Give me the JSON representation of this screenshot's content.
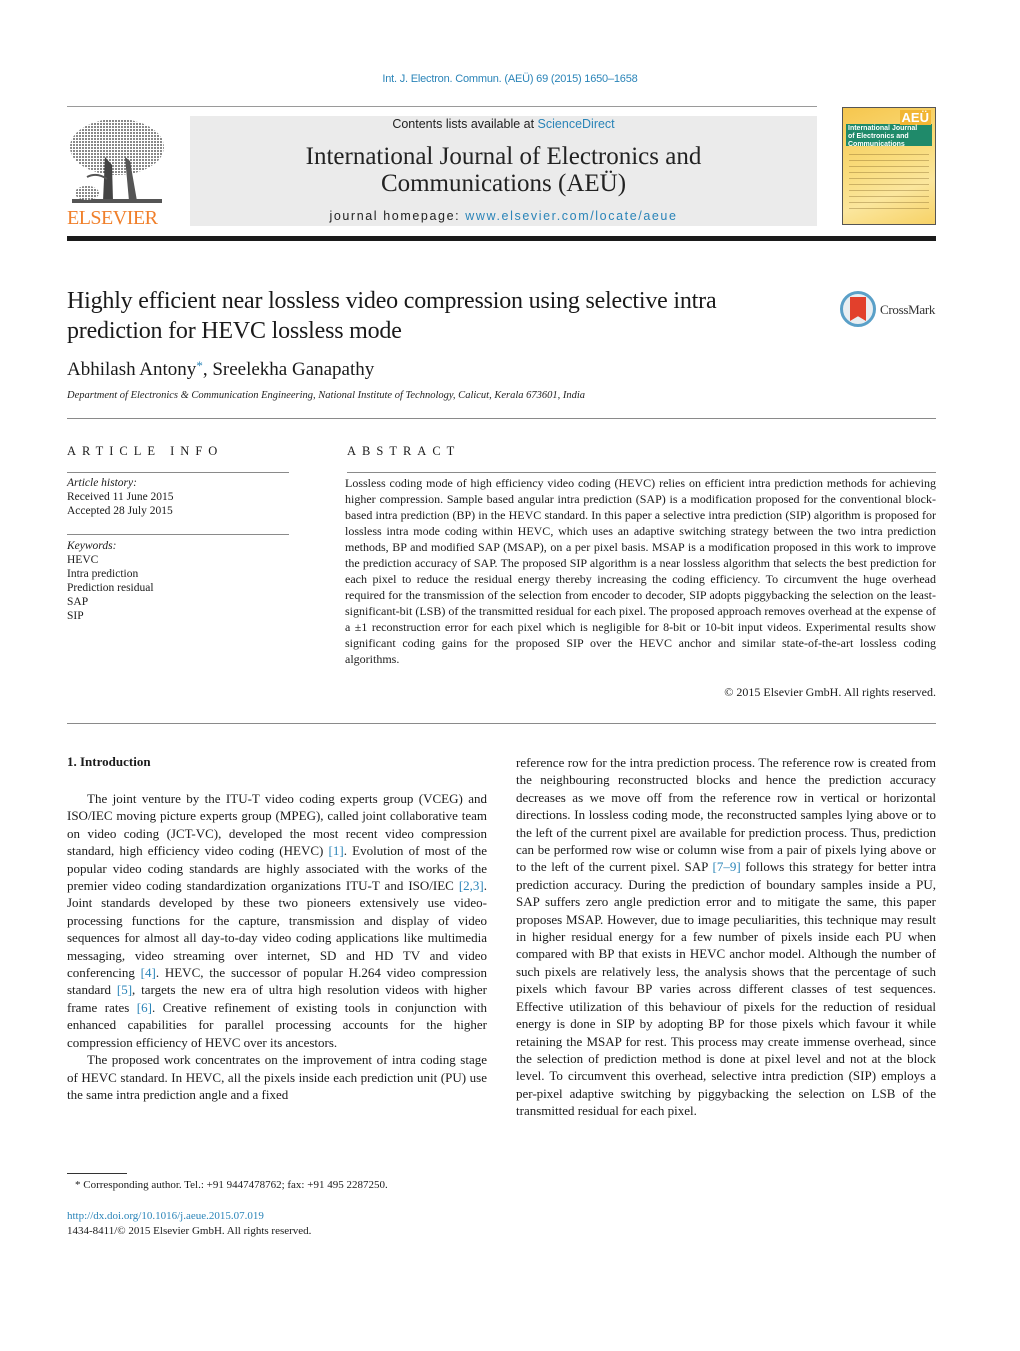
{
  "header": {
    "citation": "Int. J. Electron. Commun. (AEÜ) 69 (2015) 1650–1658",
    "contents_prefix": "Contents lists available at ",
    "contents_link": "ScienceDirect",
    "journal_title_line1": "International Journal of Electronics and",
    "journal_title_line2": "Communications (AEÜ)",
    "homepage_prefix": "journal homepage: ",
    "homepage_link": "www.elsevier.com/locate/aeue",
    "publisher_logo_text": "ELSEVIER",
    "cover": {
      "badge": "AEÜ",
      "title_line1": "International Journal",
      "title_line2": "of Electronics and",
      "title_line3": "Communications"
    },
    "colors": {
      "link": "#2a84b8",
      "elsevier_orange": "#f07f2a",
      "masthead_bg": "#ebebeb"
    }
  },
  "article": {
    "title_line1": "Highly efficient near lossless video compression using selective intra",
    "title_line2": "prediction for HEVC lossless mode",
    "crossmark_label": "CrossMark",
    "author1": "Abhilash Antony",
    "author_marker": "*",
    "author_separator": ", ",
    "author2": "Sreelekha Ganapathy",
    "affiliation": "Department of Electronics & Communication Engineering, National Institute of Technology, Calicut, Kerala 673601, India"
  },
  "article_info": {
    "heading": "ARTICLE INFO",
    "history_label": "Article history:",
    "received": "Received 11 June 2015",
    "accepted": "Accepted 28 July 2015",
    "keywords_label": "Keywords:",
    "keywords": [
      "HEVC",
      "Intra prediction",
      "Prediction residual",
      "SAP",
      "SIP"
    ]
  },
  "abstract": {
    "heading": "ABSTRACT",
    "text": "Lossless coding mode of high efficiency video coding (HEVC) relies on efficient intra prediction methods for achieving higher compression. Sample based angular intra prediction (SAP) is a modification proposed for the conventional block-based intra prediction (BP) in the HEVC standard. In this paper a selective intra prediction (SIP) algorithm is proposed for lossless intra mode coding within HEVC, which uses an adaptive switching strategy between the two intra prediction methods, BP and modified SAP (MSAP), on a per pixel basis. MSAP is a modification proposed in this work to improve the prediction accuracy of SAP. The proposed SIP algorithm is a near lossless algorithm that selects the best prediction for each pixel to reduce the residual energy thereby increasing the coding efficiency. To circumvent the huge overhead required for the transmission of the selection from encoder to decoder, SIP adopts piggybacking the selection on the least-significant-bit (LSB) of the transmitted residual for each pixel. The proposed approach removes overhead at the expense of a ±1 reconstruction error for each pixel which is negligible for 8-bit or 10-bit input videos. Experimental results show significant coding gains for the proposed SIP over the HEVC anchor and similar state-of-the-art lossless coding algorithms.",
    "copyright": "© 2015 Elsevier GmbH. All rights reserved."
  },
  "body": {
    "section_title": "1.  Introduction",
    "p1": [
      {
        "t": "The joint venture by the ITU-T video coding experts group (VCEG) and ISO/IEC moving picture experts group (MPEG), called joint collaborative team on video coding (JCT-VC), developed the most recent video compression standard, high efficiency video coding (HEVC) "
      },
      {
        "r": "[1]"
      },
      {
        "t": ". Evolution of most of the popular video coding standards are highly associated with the works of the premier video coding standardization organizations ITU-T and ISO/IEC "
      },
      {
        "r": "[2,3]"
      },
      {
        "t": ". Joint standards developed by these two pioneers extensively use video-processing functions for the capture, transmission and display of video sequences for almost all day-to-day video coding applications like multimedia messaging, video streaming over internet, SD and HD TV and video conferencing "
      },
      {
        "r": "[4]"
      },
      {
        "t": ". HEVC, the successor of popular H.264 video compression standard "
      },
      {
        "r": "[5]"
      },
      {
        "t": ", targets the new era of ultra high resolution videos with higher frame rates "
      },
      {
        "r": "[6]"
      },
      {
        "t": ". Creative refinement of existing tools in conjunction with enhanced capabilities for parallel processing accounts for the higher compression efficiency of HEVC over its ancestors."
      }
    ],
    "p2": [
      {
        "t": "The proposed work concentrates on the improvement of intra coding stage of HEVC standard. In HEVC, all the pixels inside each prediction unit (PU) use the same intra prediction angle and a fixed"
      }
    ],
    "p3": [
      {
        "t": "reference row for the intra prediction process. The reference row is created from the neighbouring reconstructed blocks and hence the prediction accuracy decreases as we move off from the reference row in vertical or horizontal directions. In lossless coding mode, the reconstructed samples lying above or to the left of the current pixel are available for prediction process. Thus, prediction can be performed row wise or column wise from a pair of pixels lying above or to the left of the current pixel. SAP "
      },
      {
        "r": "[7–9]"
      },
      {
        "t": " follows this strategy for better intra prediction accuracy. During the prediction of boundary samples inside a PU, SAP suffers zero angle prediction error and to mitigate the same, this paper proposes MSAP. However, due to image peculiarities, this technique may result in higher residual energy for a few number of pixels inside each PU when compared with BP that exists in HEVC anchor model. Although the number of such pixels are relatively less, the analysis shows that the percentage of such pixels which favour BP varies across different classes of test sequences. Effective utilization of this behaviour of pixels for the reduction of residual energy is done in SIP by adopting BP for those pixels which favour it while retaining the MSAP for rest. This process may create immense overhead, since the selection of prediction method is done at pixel level and not at the block level. To circumvent this overhead, selective intra prediction (SIP) employs a per-pixel adaptive switching by piggybacking the selection on LSB of the transmitted residual for each pixel."
      }
    ]
  },
  "footer": {
    "footnote": "*  Corresponding author. Tel.: +91 9447478762; fax: +91 495 2287250.",
    "doi": "http://dx.doi.org/10.1016/j.aeue.2015.07.019",
    "issn": "1434-8411/© 2015 Elsevier GmbH. All rights reserved."
  }
}
